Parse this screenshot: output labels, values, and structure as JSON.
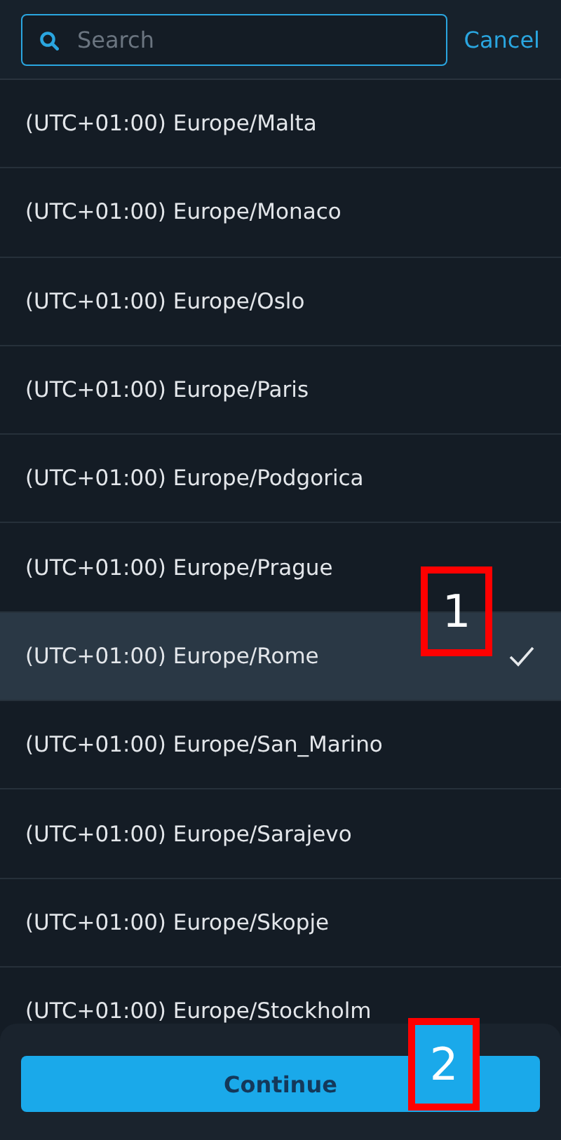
{
  "search": {
    "placeholder": "Search"
  },
  "cancel": "Cancel",
  "timezones": [
    {
      "label": "(UTC+01:00) Europe/Malta",
      "selected": false
    },
    {
      "label": "(UTC+01:00) Europe/Monaco",
      "selected": false
    },
    {
      "label": "(UTC+01:00) Europe/Oslo",
      "selected": false
    },
    {
      "label": "(UTC+01:00) Europe/Paris",
      "selected": false
    },
    {
      "label": "(UTC+01:00) Europe/Podgorica",
      "selected": false
    },
    {
      "label": "(UTC+01:00) Europe/Prague",
      "selected": false
    },
    {
      "label": "(UTC+01:00) Europe/Rome",
      "selected": true,
      "annotation": "1"
    },
    {
      "label": "(UTC+01:00) Europe/San_Marino",
      "selected": false
    },
    {
      "label": "(UTC+01:00) Europe/Sarajevo",
      "selected": false
    },
    {
      "label": "(UTC+01:00) Europe/Skopje",
      "selected": false
    },
    {
      "label": "(UTC+01:00) Europe/Stockholm",
      "selected": false
    }
  ],
  "continue_button": {
    "label": "Continue",
    "annotation": "2"
  }
}
